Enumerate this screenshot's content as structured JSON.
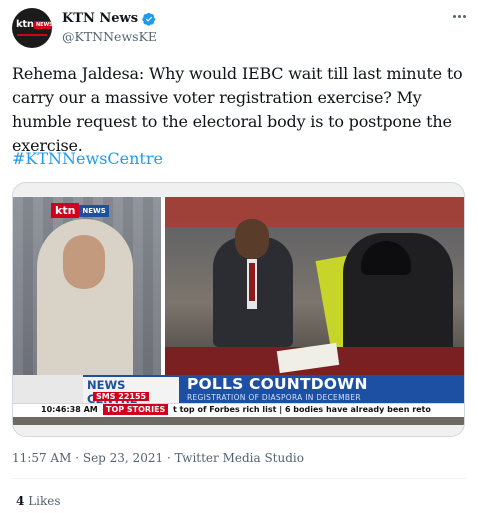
{
  "author": {
    "display_name": "KTN News",
    "handle": "@KTNNewsKE",
    "avatar_logo": "ktn",
    "avatar_badge": "NEWS",
    "verified_color": "#1d9bf0"
  },
  "tweet": {
    "text": "Rehema Jaldesa: Why would IEBC wait till last minute to carry our a massive voter registration exercise? My humble request to the electoral body is to postpone the exercise.",
    "hashtag": "#KTNNewsCentre"
  },
  "media": {
    "ktn_logo": "ktn",
    "ktn_badge": "NEWS",
    "news_centre": "NEWS CENTRE",
    "sms": "SMS 22155",
    "headline": "POLLS COUNTDOWN",
    "subheadline": "REGISTRATION OF DIASPORA IN DECEMBER",
    "ticker_time": "10:46:38 AM",
    "ticker_label": "TOP STORIES",
    "ticker_text": "t top of Forbes rich list  |  6 bodies have already been reto"
  },
  "meta": {
    "time": "11:57 AM",
    "sep1": "·",
    "date": "Sep 23, 2021",
    "sep2": "·",
    "source": "Twitter Media Studio"
  },
  "stats": {
    "likes_count": "4",
    "likes_label": "Likes"
  },
  "colors": {
    "accent": "#1d9bf0",
    "text_secondary": "#536471",
    "ktn_red": "#d0021b",
    "ktn_blue": "#1d4fa3"
  },
  "icons": [
    "verified-badge-icon",
    "more-options-icon"
  ]
}
